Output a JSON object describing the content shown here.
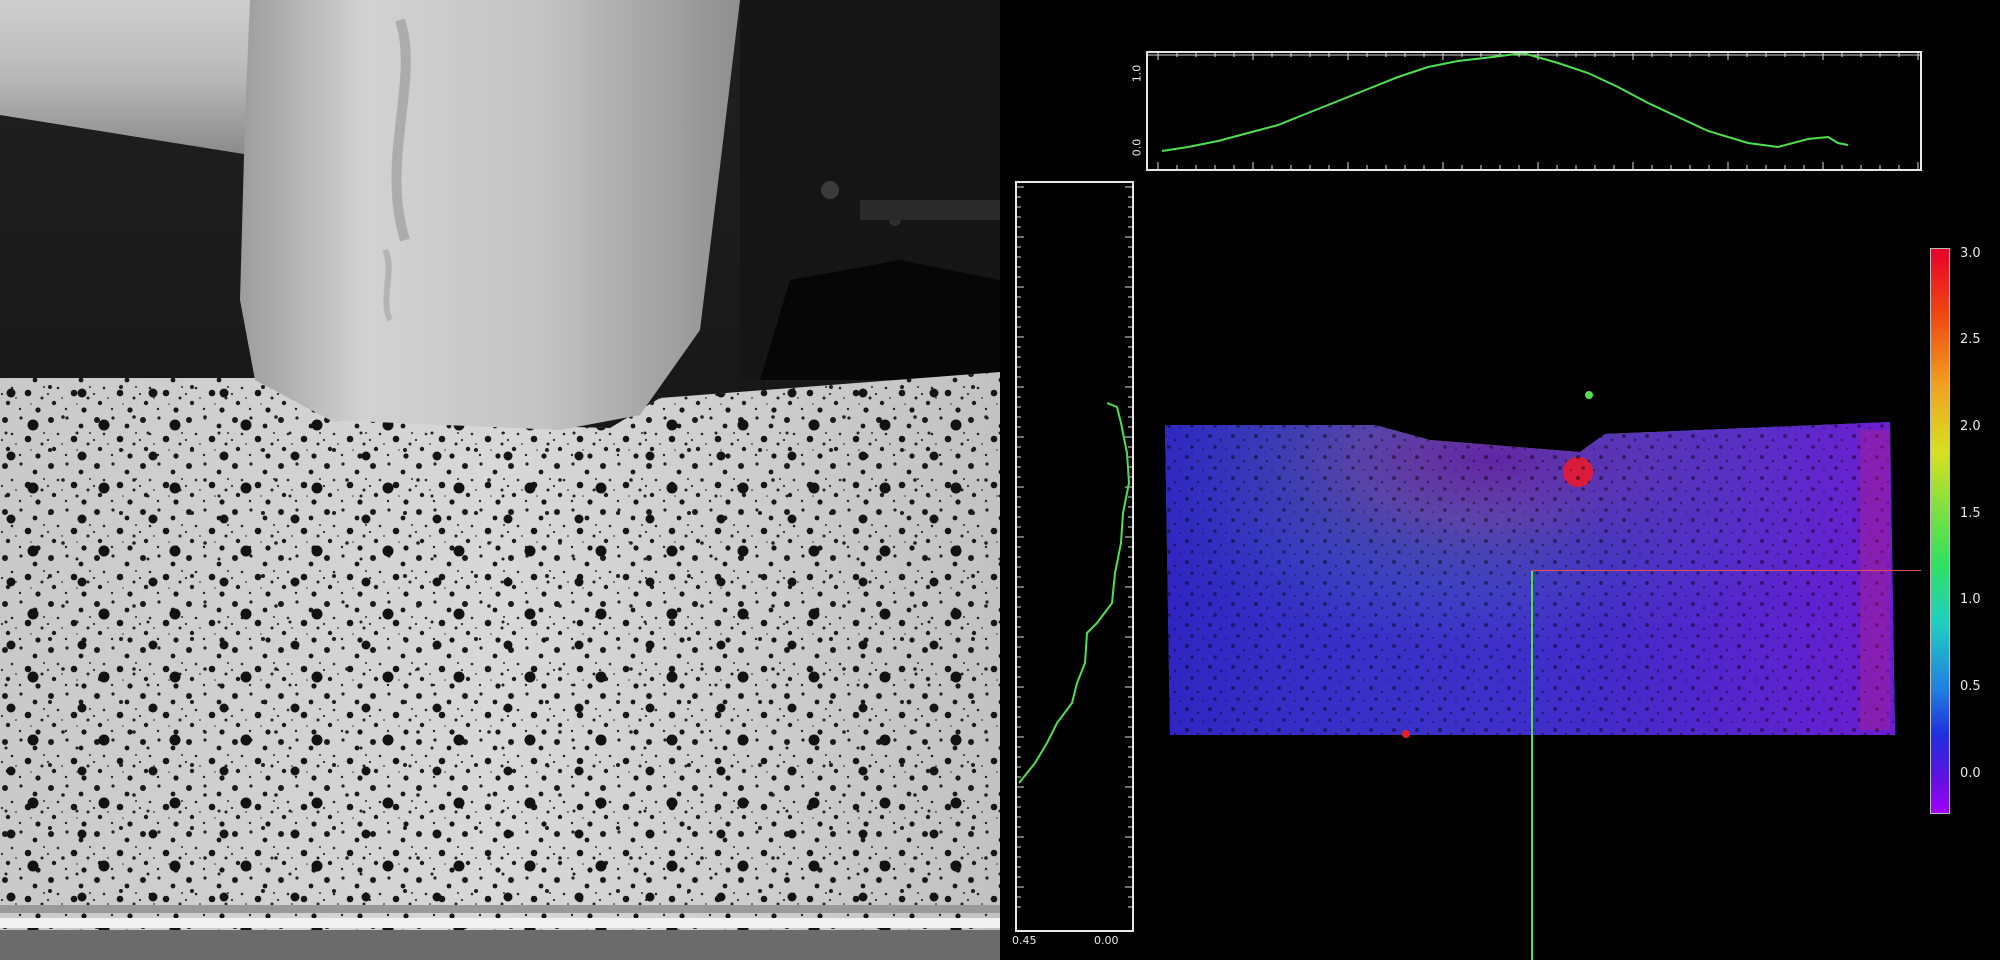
{
  "camera_view": {
    "description_icon": "hammer-icon"
  },
  "top_profile": {
    "y_ticks": [
      "1.0",
      "0.0"
    ],
    "line_color": "#4fe04f"
  },
  "left_profile": {
    "x_ticks": [
      "0.45",
      "0.00"
    ],
    "line_color": "#4fe04f"
  },
  "colorbar": {
    "ticks": [
      "3.0",
      "2.5",
      "2.0",
      "1.5",
      "1.0",
      "0.5",
      "0.0"
    ],
    "max_color": "#e8002a",
    "min_color": "#9a00ff"
  },
  "markers": {
    "top_marker_color": "#4fe04f",
    "bottom_marker_color": "#e0202a"
  },
  "crosshair": {
    "vertical_color": "#4fe04f",
    "horizontal_color": "#e05050"
  }
}
